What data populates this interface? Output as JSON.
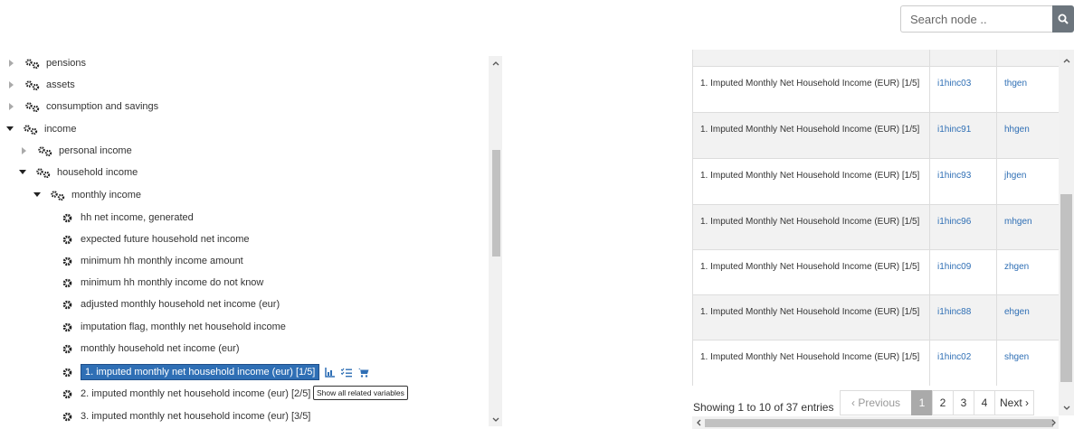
{
  "search": {
    "placeholder": "Search node ..",
    "icon": "search-icon"
  },
  "tree": {
    "nodes": [
      {
        "label": "pensions"
      },
      {
        "label": "assets"
      },
      {
        "label": "consumption and savings"
      },
      {
        "label": "income"
      },
      {
        "label": "personal income"
      },
      {
        "label": "household income"
      },
      {
        "label": "monthly income"
      }
    ],
    "leaves": [
      {
        "label": "hh net income, generated"
      },
      {
        "label": "expected future household net income"
      },
      {
        "label": "minimum hh monthly income amount"
      },
      {
        "label": "minimum hh monthly income do not know"
      },
      {
        "label": "adjusted monthly household net income (eur)"
      },
      {
        "label": "imputation flag, monthly net household income"
      },
      {
        "label": "monthly household net income (eur)"
      },
      {
        "label": "1. imputed monthly net household income (eur) [1/5]"
      },
      {
        "label": "2. imputed monthly net household income (eur) [2/5]"
      },
      {
        "label": "3. imputed monthly net household income (eur) [3/5]"
      }
    ],
    "tooltip": "Show all related variables",
    "accent_color": "#2f6fb5"
  },
  "table": {
    "rows": [
      {
        "label": "1. Imputed Monthly Net Household Income (EUR) [1/5]",
        "variable": "i1hinc03",
        "dataset": "thgen"
      },
      {
        "label": "1. Imputed Monthly Net Household Income (EUR) [1/5]",
        "variable": "i1hinc91",
        "dataset": "hhgen"
      },
      {
        "label": "1. Imputed Monthly Net Household Income (EUR) [1/5]",
        "variable": "i1hinc93",
        "dataset": "jhgen"
      },
      {
        "label": "1. Imputed Monthly Net Household Income (EUR) [1/5]",
        "variable": "i1hinc96",
        "dataset": "mhgen"
      },
      {
        "label": "1. Imputed Monthly Net Household Income (EUR) [1/5]",
        "variable": "i1hinc09",
        "dataset": "zhgen"
      },
      {
        "label": "1. Imputed Monthly Net Household Income (EUR) [1/5]",
        "variable": "i1hinc88",
        "dataset": "ehgen"
      },
      {
        "label": "1. Imputed Monthly Net Household Income (EUR) [1/5]",
        "variable": "i1hinc02",
        "dataset": "shgen"
      }
    ],
    "info": "Showing 1 to 10 of 37 entries",
    "pagination": {
      "previous": "‹ Previous",
      "pages": [
        "1",
        "2",
        "3",
        "4"
      ],
      "next": "Next ›"
    }
  }
}
